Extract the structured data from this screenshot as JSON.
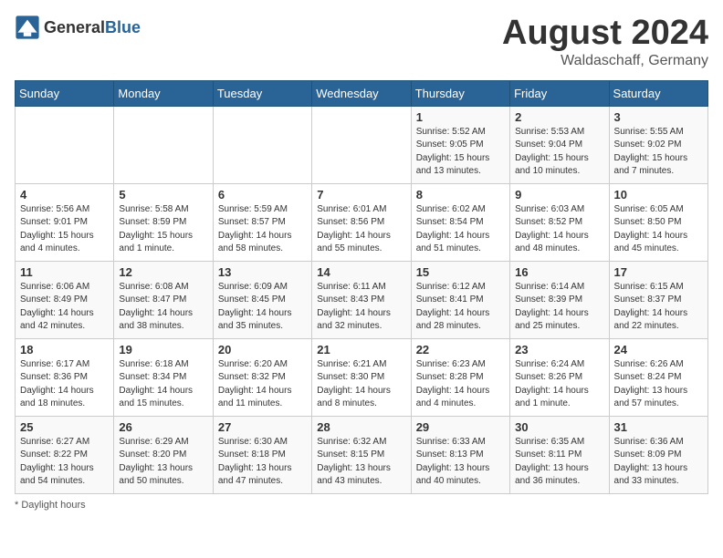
{
  "header": {
    "logo_general": "General",
    "logo_blue": "Blue",
    "month_year": "August 2024",
    "location": "Waldaschaff, Germany"
  },
  "days_of_week": [
    "Sunday",
    "Monday",
    "Tuesday",
    "Wednesday",
    "Thursday",
    "Friday",
    "Saturday"
  ],
  "footer": {
    "note": "Daylight hours"
  },
  "weeks": [
    [
      {
        "day": "",
        "info": ""
      },
      {
        "day": "",
        "info": ""
      },
      {
        "day": "",
        "info": ""
      },
      {
        "day": "",
        "info": ""
      },
      {
        "day": "1",
        "info": "Sunrise: 5:52 AM\nSunset: 9:05 PM\nDaylight: 15 hours\nand 13 minutes."
      },
      {
        "day": "2",
        "info": "Sunrise: 5:53 AM\nSunset: 9:04 PM\nDaylight: 15 hours\nand 10 minutes."
      },
      {
        "day": "3",
        "info": "Sunrise: 5:55 AM\nSunset: 9:02 PM\nDaylight: 15 hours\nand 7 minutes."
      }
    ],
    [
      {
        "day": "4",
        "info": "Sunrise: 5:56 AM\nSunset: 9:01 PM\nDaylight: 15 hours\nand 4 minutes."
      },
      {
        "day": "5",
        "info": "Sunrise: 5:58 AM\nSunset: 8:59 PM\nDaylight: 15 hours\nand 1 minute."
      },
      {
        "day": "6",
        "info": "Sunrise: 5:59 AM\nSunset: 8:57 PM\nDaylight: 14 hours\nand 58 minutes."
      },
      {
        "day": "7",
        "info": "Sunrise: 6:01 AM\nSunset: 8:56 PM\nDaylight: 14 hours\nand 55 minutes."
      },
      {
        "day": "8",
        "info": "Sunrise: 6:02 AM\nSunset: 8:54 PM\nDaylight: 14 hours\nand 51 minutes."
      },
      {
        "day": "9",
        "info": "Sunrise: 6:03 AM\nSunset: 8:52 PM\nDaylight: 14 hours\nand 48 minutes."
      },
      {
        "day": "10",
        "info": "Sunrise: 6:05 AM\nSunset: 8:50 PM\nDaylight: 14 hours\nand 45 minutes."
      }
    ],
    [
      {
        "day": "11",
        "info": "Sunrise: 6:06 AM\nSunset: 8:49 PM\nDaylight: 14 hours\nand 42 minutes."
      },
      {
        "day": "12",
        "info": "Sunrise: 6:08 AM\nSunset: 8:47 PM\nDaylight: 14 hours\nand 38 minutes."
      },
      {
        "day": "13",
        "info": "Sunrise: 6:09 AM\nSunset: 8:45 PM\nDaylight: 14 hours\nand 35 minutes."
      },
      {
        "day": "14",
        "info": "Sunrise: 6:11 AM\nSunset: 8:43 PM\nDaylight: 14 hours\nand 32 minutes."
      },
      {
        "day": "15",
        "info": "Sunrise: 6:12 AM\nSunset: 8:41 PM\nDaylight: 14 hours\nand 28 minutes."
      },
      {
        "day": "16",
        "info": "Sunrise: 6:14 AM\nSunset: 8:39 PM\nDaylight: 14 hours\nand 25 minutes."
      },
      {
        "day": "17",
        "info": "Sunrise: 6:15 AM\nSunset: 8:37 PM\nDaylight: 14 hours\nand 22 minutes."
      }
    ],
    [
      {
        "day": "18",
        "info": "Sunrise: 6:17 AM\nSunset: 8:36 PM\nDaylight: 14 hours\nand 18 minutes."
      },
      {
        "day": "19",
        "info": "Sunrise: 6:18 AM\nSunset: 8:34 PM\nDaylight: 14 hours\nand 15 minutes."
      },
      {
        "day": "20",
        "info": "Sunrise: 6:20 AM\nSunset: 8:32 PM\nDaylight: 14 hours\nand 11 minutes."
      },
      {
        "day": "21",
        "info": "Sunrise: 6:21 AM\nSunset: 8:30 PM\nDaylight: 14 hours\nand 8 minutes."
      },
      {
        "day": "22",
        "info": "Sunrise: 6:23 AM\nSunset: 8:28 PM\nDaylight: 14 hours\nand 4 minutes."
      },
      {
        "day": "23",
        "info": "Sunrise: 6:24 AM\nSunset: 8:26 PM\nDaylight: 14 hours\nand 1 minute."
      },
      {
        "day": "24",
        "info": "Sunrise: 6:26 AM\nSunset: 8:24 PM\nDaylight: 13 hours\nand 57 minutes."
      }
    ],
    [
      {
        "day": "25",
        "info": "Sunrise: 6:27 AM\nSunset: 8:22 PM\nDaylight: 13 hours\nand 54 minutes."
      },
      {
        "day": "26",
        "info": "Sunrise: 6:29 AM\nSunset: 8:20 PM\nDaylight: 13 hours\nand 50 minutes."
      },
      {
        "day": "27",
        "info": "Sunrise: 6:30 AM\nSunset: 8:18 PM\nDaylight: 13 hours\nand 47 minutes."
      },
      {
        "day": "28",
        "info": "Sunrise: 6:32 AM\nSunset: 8:15 PM\nDaylight: 13 hours\nand 43 minutes."
      },
      {
        "day": "29",
        "info": "Sunrise: 6:33 AM\nSunset: 8:13 PM\nDaylight: 13 hours\nand 40 minutes."
      },
      {
        "day": "30",
        "info": "Sunrise: 6:35 AM\nSunset: 8:11 PM\nDaylight: 13 hours\nand 36 minutes."
      },
      {
        "day": "31",
        "info": "Sunrise: 6:36 AM\nSunset: 8:09 PM\nDaylight: 13 hours\nand 33 minutes."
      }
    ]
  ]
}
